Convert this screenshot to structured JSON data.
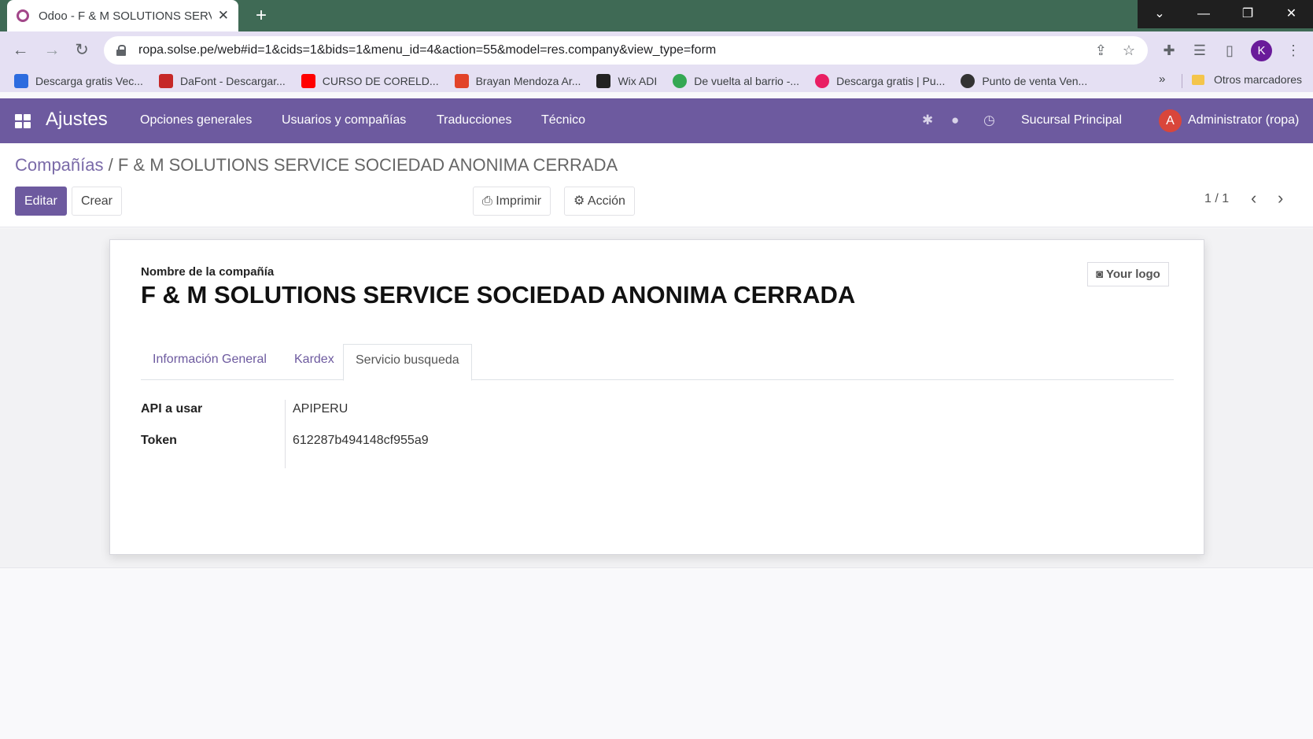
{
  "browser": {
    "tab_title": "Odoo - F & M SOLUTIONS SERVICE SOCIEDAD ANONIMA CERRADA",
    "url": "ropa.solse.pe/web#id=1&cids=1&bids=1&menu_id=4&action=55&model=res.company&view_type=form",
    "profile_initial": "K",
    "bookmarks": [
      {
        "label": "Descarga gratis Vec...",
        "color": "#2d6cdf"
      },
      {
        "label": "DaFont - Descargar...",
        "color": "#c62828"
      },
      {
        "label": "CURSO DE CORELD...",
        "color": "#ff0000"
      },
      {
        "label": "Brayan Mendoza Ar...",
        "color": "#e24329"
      },
      {
        "label": "Wix ADI",
        "color": "#222222"
      },
      {
        "label": "De vuelta al barrio -...",
        "color": "#34a853"
      },
      {
        "label": "Descarga gratis | Pu...",
        "color": "#e91e63"
      },
      {
        "label": "Punto de venta Ven...",
        "color": "#333333"
      }
    ],
    "more_bookmarks": "»",
    "other_bookmarks": "Otros marcadores"
  },
  "navbar": {
    "app_name": "Ajustes",
    "menu": [
      "Opciones generales",
      "Usuarios y compañías",
      "Traducciones",
      "Técnico"
    ],
    "branch": "Sucursal Principal",
    "user_initial": "A",
    "user": "Administrator (ropa)"
  },
  "control": {
    "breadcrumb_parent": "Compañías",
    "breadcrumb_sep": " / ",
    "breadcrumb_current": "F & M SOLUTIONS SERVICE SOCIEDAD ANONIMA CERRADA",
    "edit_label": "Editar",
    "create_label": "Crear",
    "print_label": "Imprimir",
    "action_label": "Acción",
    "pager": "1 / 1"
  },
  "form": {
    "name_label": "Nombre de la compañía",
    "name": "F & M SOLUTIONS SERVICE SOCIEDAD ANONIMA CERRADA",
    "logo_label": "Your logo",
    "tabs": [
      "Información General",
      "Kardex",
      "Servicio busqueda"
    ],
    "active_tab": "Servicio busqueda",
    "fields": [
      {
        "label": "API a usar",
        "value": "APIPERU"
      },
      {
        "label": "Token",
        "value": "612287b494148cf955a9"
      }
    ]
  },
  "colors": {
    "brand": "#6d5a9f",
    "chrome_tabstrip": "#3f6a55",
    "chrome_toolbar": "#e5e0f3"
  }
}
